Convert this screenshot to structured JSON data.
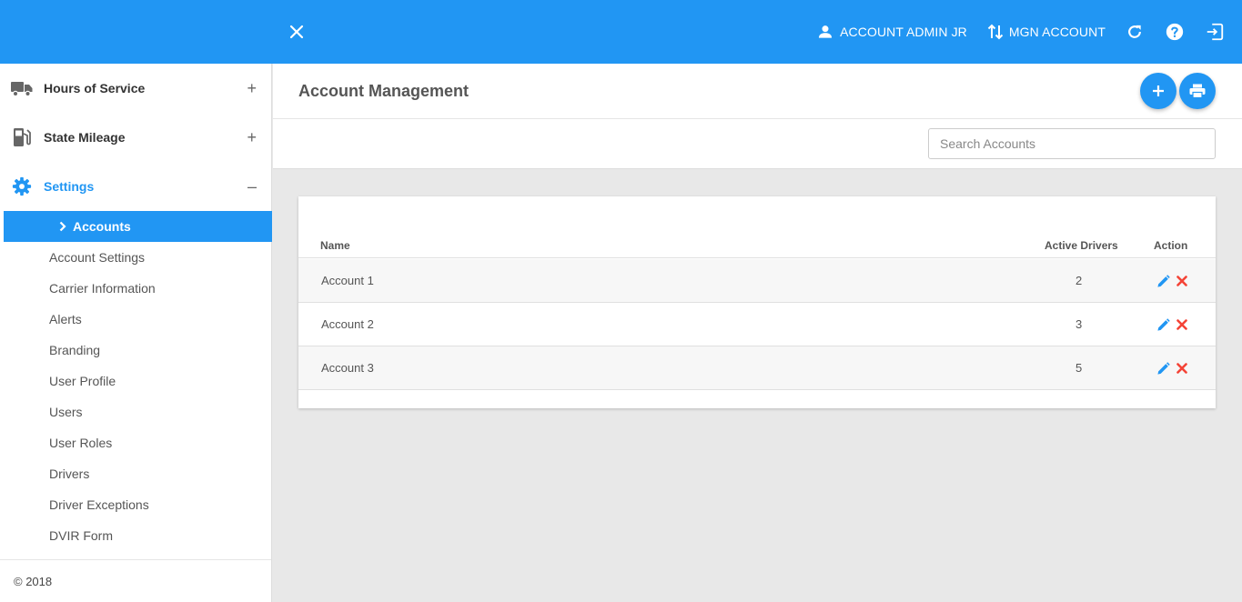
{
  "topbar": {
    "user_label": "ACCOUNT ADMIN JR",
    "account_label": "MGN ACCOUNT"
  },
  "sidebar": {
    "groups": [
      {
        "label": "Hours of Service",
        "toggle": "+",
        "icon": "truck-icon"
      },
      {
        "label": "State Mileage",
        "toggle": "+",
        "icon": "fuel-pump-icon"
      },
      {
        "label": "Settings",
        "toggle": "–",
        "icon": "gear-icon"
      }
    ],
    "active_item": "Accounts",
    "items": [
      "Account Settings",
      "Carrier Information",
      "Alerts",
      "Branding",
      "User Profile",
      "Users",
      "User Roles",
      "Drivers",
      "Driver Exceptions",
      "DVIR Form"
    ],
    "footer": "© 2018"
  },
  "main": {
    "title": "Account Management",
    "search_placeholder": "Search Accounts",
    "table": {
      "headers": [
        "Name",
        "Active Drivers",
        "Action"
      ],
      "rows": [
        {
          "name": "Account 1",
          "drivers": "2"
        },
        {
          "name": "Account 2",
          "drivers": "3"
        },
        {
          "name": "Account 3",
          "drivers": "5"
        }
      ]
    }
  },
  "colors": {
    "primary": "#2196f3",
    "delete": "#f44336"
  }
}
